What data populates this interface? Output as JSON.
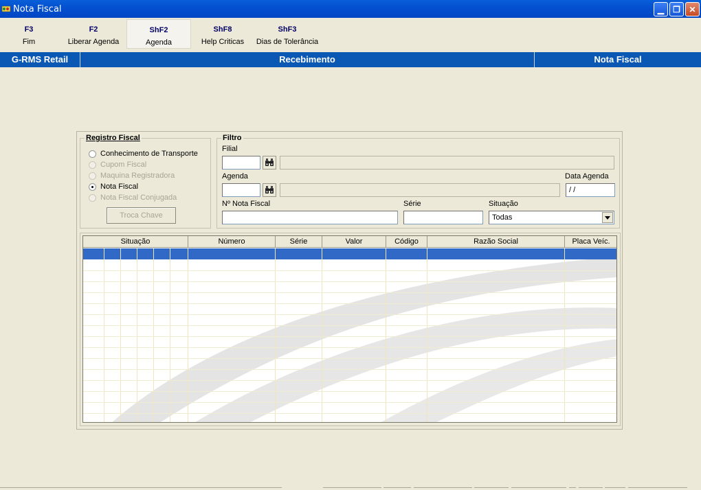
{
  "window": {
    "title": "Nota Fiscal"
  },
  "fkeys": [
    {
      "key": "F3",
      "label": "Fim"
    },
    {
      "key": "F2",
      "label": "Liberar Agenda"
    },
    {
      "key": "ShF2",
      "label": "Agenda"
    },
    {
      "key": "ShF8",
      "label": "Help Criticas"
    },
    {
      "key": "ShF3",
      "label": "Dias de Tolerância"
    }
  ],
  "header": {
    "left": "G-RMS Retail",
    "center": "Recebimento",
    "right": "Nota Fiscal"
  },
  "registro": {
    "title": "Registro Fiscal",
    "options": [
      {
        "label": "Conhecimento de Transporte",
        "checked": false,
        "enabled": true
      },
      {
        "label": "Cupom Fiscal",
        "checked": false,
        "enabled": false
      },
      {
        "label": "Maquina Registradora",
        "checked": false,
        "enabled": false
      },
      {
        "label": "Nota Fiscal",
        "checked": true,
        "enabled": true
      },
      {
        "label": "Nota Fiscal Conjugada",
        "checked": false,
        "enabled": false
      }
    ],
    "button": "Troca Chave"
  },
  "filtro": {
    "title": "Filtro",
    "filial_label": "Filial",
    "filial_value": "",
    "agenda_label": "Agenda",
    "agenda_value": "",
    "data_agenda_label": "Data Agenda",
    "data_agenda_value": " / /",
    "nota_label": "Nº Nota Fiscal",
    "nota_value": "",
    "serie_label": "Série",
    "serie_value": "",
    "situacao_label": "Situação",
    "situacao_value": "Todas"
  },
  "grid": {
    "columns": [
      "Situação",
      "Número",
      "Série",
      "Valor",
      "Código",
      "Razão Social",
      "Placa Veíc."
    ]
  },
  "icons": {
    "find": "binoculars-icon",
    "app": "app-icon"
  },
  "colors": {
    "accent": "#0b58b4",
    "selection": "#3169c6"
  }
}
